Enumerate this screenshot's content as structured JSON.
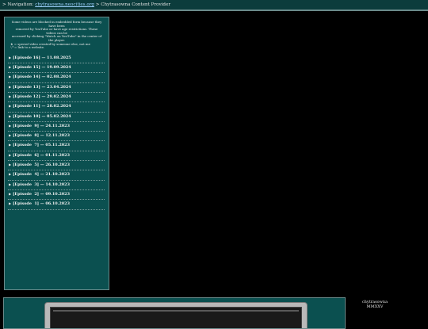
{
  "nav": {
    "prefix": "> Navigation:",
    "link": "chytrasowna.neocities.org",
    "separator": ">",
    "current": "Chytrasowna Content Provider"
  },
  "notice": {
    "lines": [
      "Some videos are blocked in embedded form because they have been",
      "removed by YouTube or have age restrictions. These videos can be",
      "accessed by clicking \"Watch on YouTube\" in the center of the player."
    ],
    "legend": [
      "★ = special video created by someone else, not me",
      "🖓 = link to a website."
    ]
  },
  "episodes": [
    "[Episode 16] — 11.08.2025",
    "[Episode 15] — 19.09.2024",
    "[Episode 14] — 02.08.2024",
    "[Episode 13] — 23.04.2024",
    "[Episode 12] — 29.02.2024",
    "[Episode 11] — 28.02.2024",
    "[Episode 10] — 05.02.2024",
    "[Episode  9] — 24.11.2023",
    "[Episode  8] — 12.11.2023",
    "[Episode  7] — 05.11.2023",
    "[Episode  6] — 01.11.2023",
    "[Episode  5] — 26.10.2023",
    "[Episode  4] — 21.10.2023",
    "[Episode  3] — 14.10.2023",
    "[Episode  2] — 09.10.2023",
    "[Episode  1] — 06.10.2023"
  ],
  "brand": {
    "name": "chytrasowna",
    "year": "MMXXV"
  },
  "colors": {
    "panel": "#0b5050",
    "topbar": "#0c3c3c",
    "link": "#9fd3ff"
  }
}
